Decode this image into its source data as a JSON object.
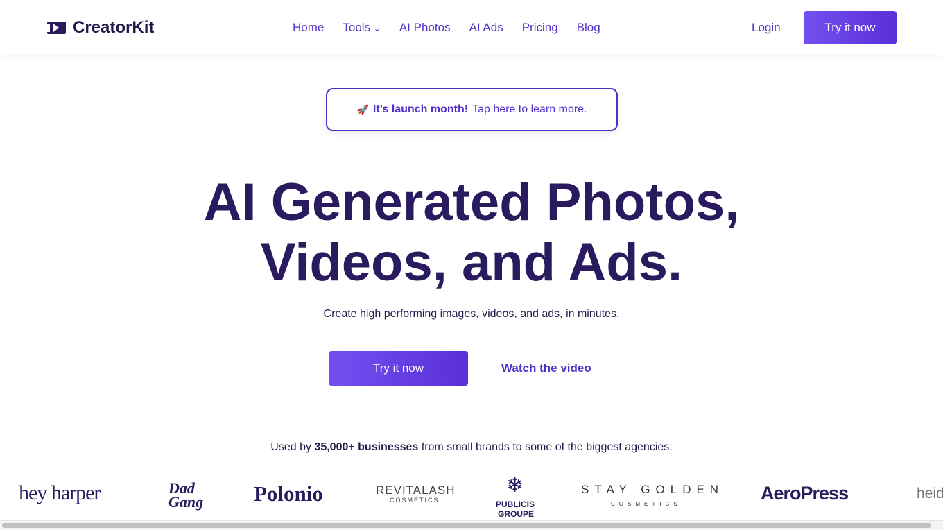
{
  "nav": {
    "brand": "CreatorKit",
    "links": [
      "Home",
      "Tools",
      "AI Photos",
      "AI Ads",
      "Pricing",
      "Blog"
    ],
    "login": "Login",
    "cta": "Try it now"
  },
  "banner": {
    "icon": "rocket-icon",
    "bold": "It’s launch month!",
    "text": "Tap here to learn more."
  },
  "hero": {
    "line1": "AI Generated Photos,",
    "line2": "Videos, and Ads.",
    "subtitle": "Create high performing images, videos, and ads, in minutes.",
    "cta": "Try it now",
    "video": "Watch the video"
  },
  "social": {
    "prefix": "Used by ",
    "count": "35,000+ businesses",
    "suffix": " from small brands to some of the biggest agencies:",
    "logos": [
      "hey harper",
      "Dad Gang",
      "Polonio",
      "REVITALASH",
      "COSMETICS",
      "PUBLICIS",
      "GROUPE",
      "STAY GOLDEN",
      "COSMETICS",
      "AeroPress",
      "heidi"
    ]
  },
  "colors": {
    "accent": "#5230c8",
    "heading": "#2a1a5e"
  }
}
